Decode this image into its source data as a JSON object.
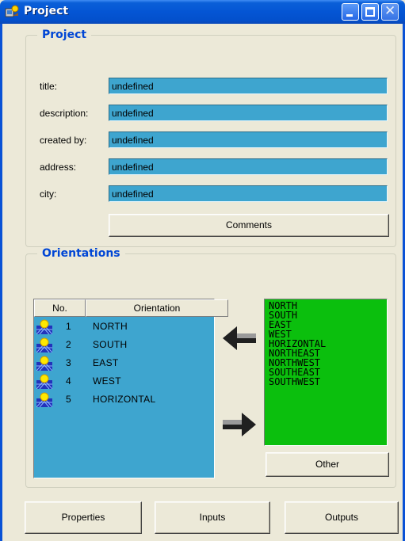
{
  "window": {
    "title": "Project"
  },
  "project": {
    "legend": "Project",
    "fields": [
      {
        "label": "title:",
        "value": "undefined"
      },
      {
        "label": "description:",
        "value": "undefined"
      },
      {
        "label": "created by:",
        "value": "undefined"
      },
      {
        "label": "address:",
        "value": "undefined"
      },
      {
        "label": "city:",
        "value": "undefined"
      }
    ],
    "comments_button": "Comments"
  },
  "orientations": {
    "legend": "Orientations",
    "columns": {
      "no": "No.",
      "orientation": "Orientation"
    },
    "rows": [
      {
        "no": "1",
        "name": "NORTH",
        "icon": "sun-icon"
      },
      {
        "no": "2",
        "name": "SOUTH",
        "icon": "sun-icon"
      },
      {
        "no": "3",
        "name": "EAST",
        "icon": "sun-icon"
      },
      {
        "no": "4",
        "name": "WEST",
        "icon": "sun-icon"
      },
      {
        "no": "5",
        "name": "HORIZONTAL",
        "icon": "sun-icon"
      }
    ],
    "available": [
      "NORTH",
      "SOUTH",
      "EAST",
      "WEST",
      "HORIZONTAL",
      "NORTHEAST",
      "NORTHWEST",
      "SOUTHEAST",
      "SOUTHWEST"
    ],
    "add_icon": "arrow-left-icon",
    "remove_icon": "arrow-right-icon",
    "other_button": "Other"
  },
  "footer": {
    "properties": "Properties",
    "inputs": "Inputs",
    "outputs": "Outputs"
  },
  "colors": {
    "titlebar": "#0455d4",
    "field_bg": "#3ea5cf",
    "list_bg": "#0bbf0d",
    "legend": "#0046d5"
  }
}
